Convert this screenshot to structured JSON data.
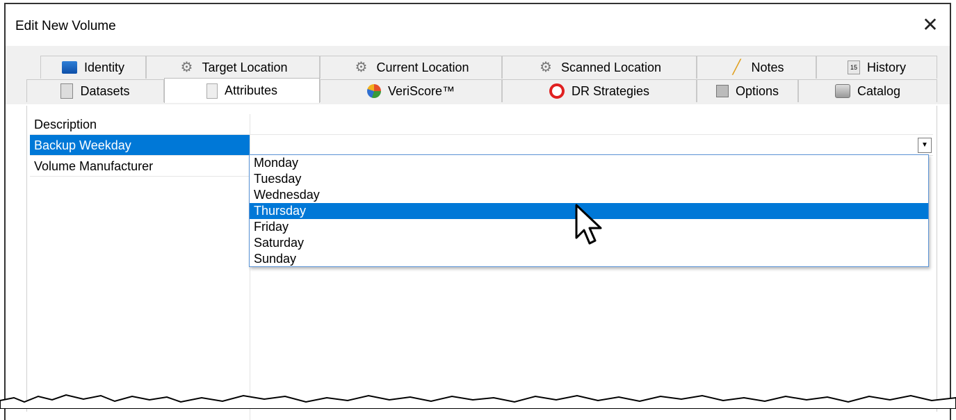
{
  "window": {
    "title": "Edit New Volume",
    "close_glyph": "✕"
  },
  "tabs_row1": [
    {
      "label": "Identity",
      "icon": "identity-icon"
    },
    {
      "label": "Target Location",
      "icon": "gear-icon"
    },
    {
      "label": "Current Location",
      "icon": "gear-icon"
    },
    {
      "label": "Scanned Location",
      "icon": "gear-icon"
    },
    {
      "label": "Notes",
      "icon": "pencil-icon"
    },
    {
      "label": "History",
      "icon": "calendar-icon"
    }
  ],
  "tabs_row2": [
    {
      "label": "Datasets",
      "icon": "dataset-icon"
    },
    {
      "label": "Attributes",
      "icon": "attributes-icon",
      "active": true
    },
    {
      "label": "VeriScore™",
      "icon": "pie-chart-icon"
    },
    {
      "label": "DR Strategies",
      "icon": "lifebuoy-icon"
    },
    {
      "label": "Options",
      "icon": "options-icon"
    },
    {
      "label": "Catalog",
      "icon": "catalog-icon"
    }
  ],
  "properties": [
    {
      "label": "Description",
      "value": ""
    },
    {
      "label": "Backup Weekday",
      "value": "",
      "selected": true
    },
    {
      "label": "Volume Manufacturer",
      "value": ""
    }
  ],
  "dropdown": {
    "options": [
      "Monday",
      "Tuesday",
      "Wednesday",
      "Thursday",
      "Friday",
      "Saturday",
      "Sunday"
    ],
    "highlighted": "Thursday",
    "button_glyph": "▼"
  }
}
